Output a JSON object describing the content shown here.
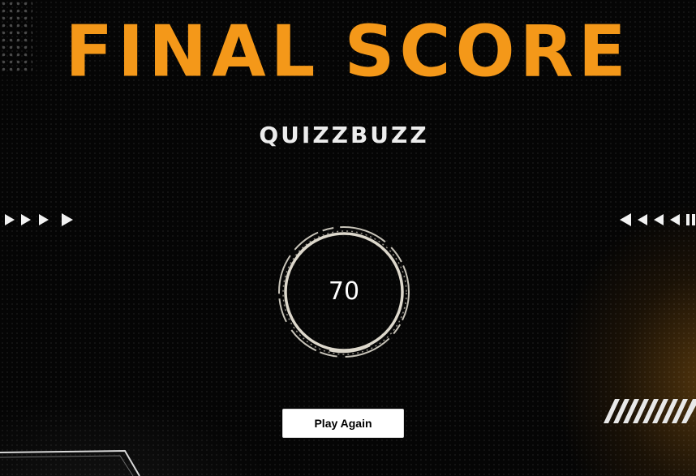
{
  "header": {
    "title_word1": "FINAL",
    "title_word2": "SCORE",
    "subtitle": "QUIZZBUZZ"
  },
  "score": {
    "value": "70"
  },
  "actions": {
    "play_again_label": "Play Again"
  },
  "colors": {
    "accent": "#f49819",
    "background": "#050505",
    "text": "#ececec"
  },
  "icons": {
    "left_arrows": "play-arrows-right-icon",
    "right_arrows": "play-arrows-left-icon",
    "score_ring": "circle-ring-icon",
    "stripes": "hazard-stripes-icon"
  }
}
